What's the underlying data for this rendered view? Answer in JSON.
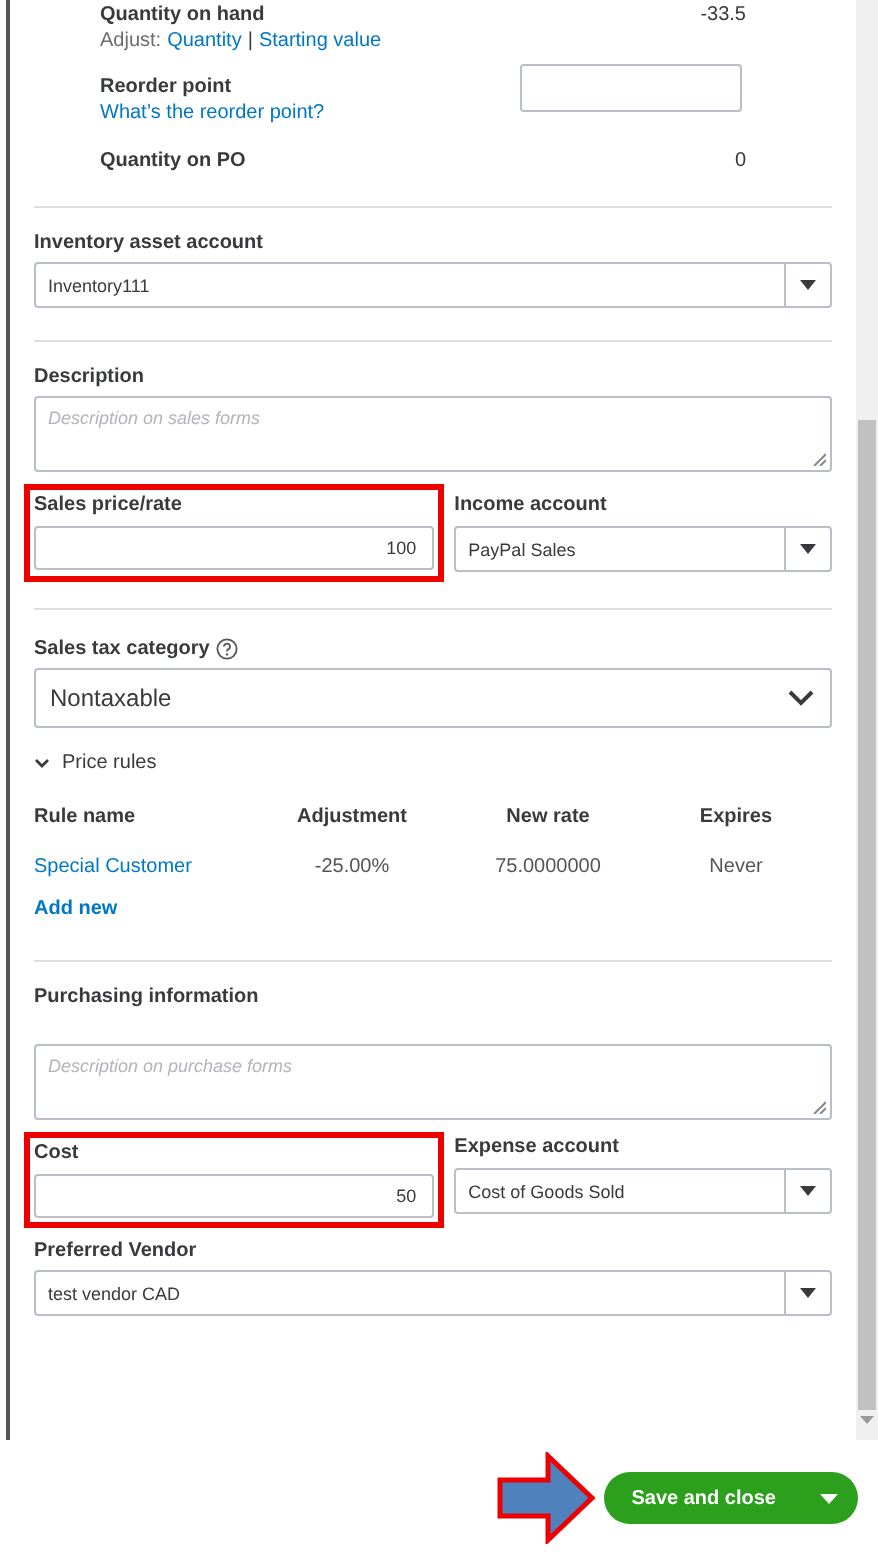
{
  "stock": {
    "quantity_on_hand": {
      "label": "Quantity on hand",
      "value": "-33.5",
      "adjust_label": "Adjust:",
      "links": [
        "Quantity",
        "Starting value"
      ],
      "separator": "|"
    },
    "reorder_point": {
      "label": "Reorder point",
      "help_link": "What’s the reorder point?"
    },
    "quantity_on_po": {
      "label": "Quantity on PO",
      "value": "0"
    }
  },
  "inventory_asset_account": {
    "label": "Inventory asset account",
    "value": "Inventory111"
  },
  "description": {
    "label": "Description",
    "placeholder": "Description on sales forms"
  },
  "sales_price": {
    "label": "Sales price/rate",
    "value": "100",
    "highlighted": true
  },
  "income_account": {
    "label": "Income account",
    "value": "PayPal Sales"
  },
  "sales_tax_category": {
    "label": "Sales tax category",
    "value": "Nontaxable"
  },
  "price_rules": {
    "title": "Price rules",
    "expanded": true,
    "columns": [
      "Rule name",
      "Adjustment",
      "New rate",
      "Expires"
    ],
    "rows": [
      {
        "rule_name": "Special Customer",
        "adjustment": "-25.00%",
        "new_rate": "75.0000000",
        "expires": "Never"
      }
    ],
    "add_link": "Add new"
  },
  "purchasing": {
    "title": "Purchasing information",
    "placeholder": "Description on purchase forms"
  },
  "cost": {
    "label": "Cost",
    "value": "50",
    "highlighted": true
  },
  "expense_account": {
    "label": "Expense account",
    "value": "Cost of Goods Sold"
  },
  "preferred_vendor": {
    "label": "Preferred Vendor",
    "value": "test vendor CAD"
  },
  "save_button": {
    "label": "Save and close",
    "callout_arrow": true
  }
}
